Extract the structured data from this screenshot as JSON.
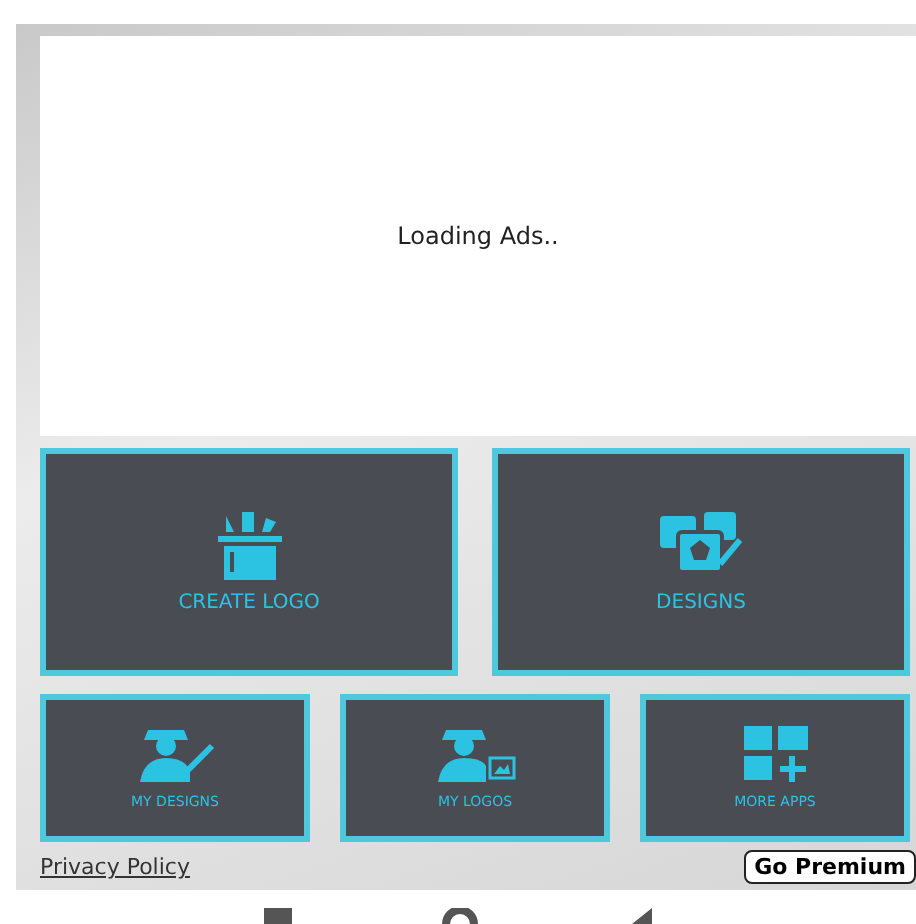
{
  "ad": {
    "text": "Loading Ads.."
  },
  "tiles": [
    {
      "label": "CREATE LOGO",
      "kind": "create"
    },
    {
      "label": "DESIGNS",
      "kind": "designs"
    },
    {
      "label": "MY DESIGNS",
      "kind": "mydesigns"
    },
    {
      "label": "MY LOGOS",
      "kind": "mylogos"
    },
    {
      "label": "MORE APPS",
      "kind": "moreapps"
    }
  ],
  "footer": {
    "link": "Privacy Policy",
    "button": "Go Premium"
  },
  "nav_bar": [
    {
      "kind": "recents"
    },
    {
      "kind": "home"
    },
    {
      "kind": "back"
    }
  ]
}
